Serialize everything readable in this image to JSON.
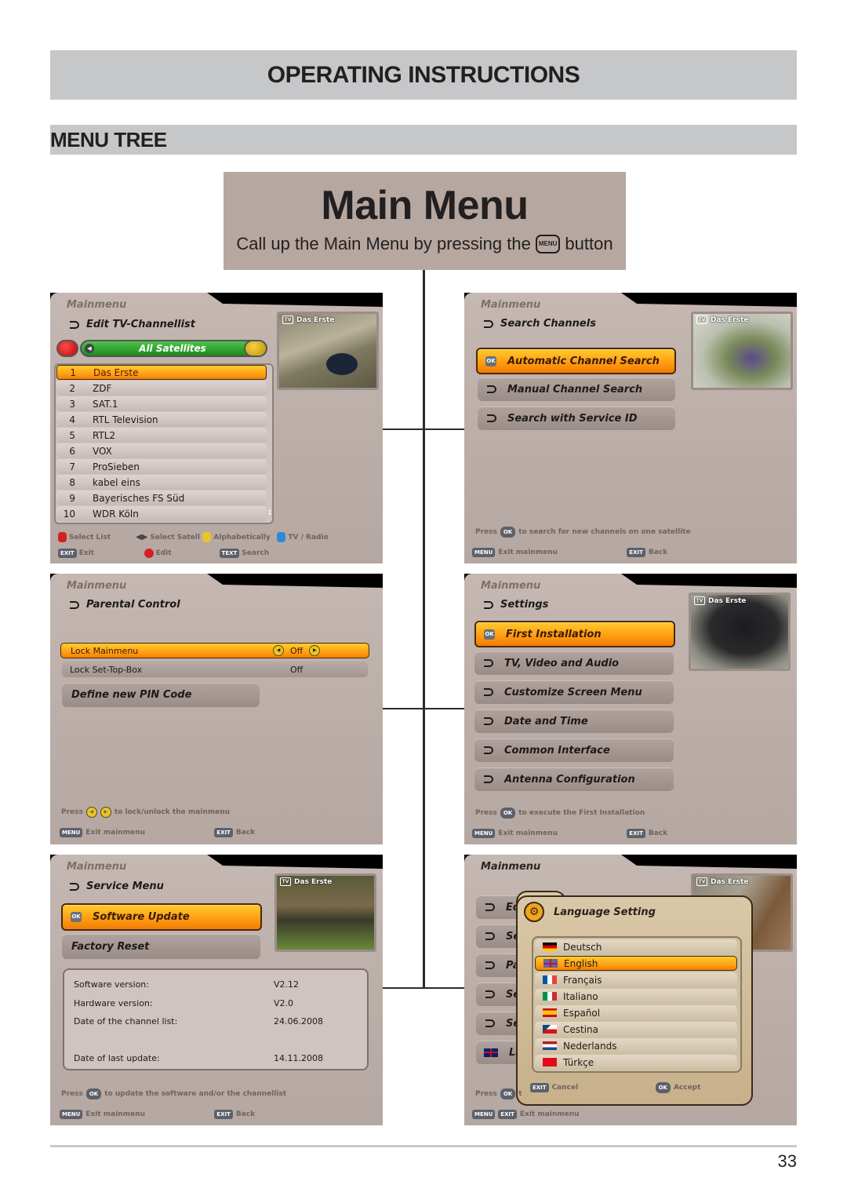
{
  "header": {
    "title": "OPERATING INSTRUCTIONS"
  },
  "section": {
    "title": "MENU TREE"
  },
  "main_menu": {
    "title": "Main Menu",
    "subtitle_before": "Call up the Main Menu by pressing the",
    "key_label": "MENU",
    "subtitle_after": "button"
  },
  "common": {
    "mainmenu": "Mainmenu",
    "channel_thumb": "Das Erste",
    "tv_icon": "TV"
  },
  "panel_channellist": {
    "title": "Edit TV-Channellist",
    "satellite_selector": "All Satellites",
    "channels": [
      {
        "num": "1",
        "name": "Das Erste",
        "selected": true
      },
      {
        "num": "2",
        "name": "ZDF"
      },
      {
        "num": "3",
        "name": "SAT.1"
      },
      {
        "num": "4",
        "name": "RTL Television"
      },
      {
        "num": "5",
        "name": "RTL2"
      },
      {
        "num": "6",
        "name": "VOX"
      },
      {
        "num": "7",
        "name": "ProSieben"
      },
      {
        "num": "8",
        "name": "kabel eins"
      },
      {
        "num": "9",
        "name": "Bayerisches FS Süd"
      },
      {
        "num": "10",
        "name": "WDR Köln"
      }
    ],
    "legend": {
      "select_list": "Select List",
      "select_satellite": "Select Satelli",
      "alphabetically": "Alphabetically",
      "tv_radio": "TV / Radio",
      "exit_key": "EXIT",
      "exit": "Exit",
      "edit": "Edit",
      "text_key": "TEXT",
      "search": "Search"
    }
  },
  "panel_search": {
    "title": "Search Channels",
    "items": [
      {
        "label": "Automatic Channel Search",
        "selected": true
      },
      {
        "label": "Manual Channel Search"
      },
      {
        "label": "Search with Service ID"
      }
    ],
    "hint_press": "Press",
    "hint_key": "OK",
    "hint_text": "to search for new channels on one satellite",
    "menu_key": "MENU",
    "exit_mainmenu": "Exit mainmenu",
    "exit_key": "EXIT",
    "back": "Back"
  },
  "panel_parental": {
    "title": "Parental Control",
    "rows": [
      {
        "label": "Lock Mainmenu",
        "value": "Off",
        "selected": true
      },
      {
        "label": "Lock Set-Top-Box",
        "value": "Off"
      }
    ],
    "define_pin": "Define new PIN Code",
    "hint_press": "Press",
    "hint_text": "to lock/unlock the mainmenu",
    "menu_key": "MENU",
    "exit_mainmenu": "Exit mainmenu",
    "exit_key": "EXIT",
    "back": "Back"
  },
  "panel_settings": {
    "title": "Settings",
    "items": [
      {
        "label": "First Installation",
        "selected": true
      },
      {
        "label": "TV, Video and Audio"
      },
      {
        "label": "Customize Screen Menu"
      },
      {
        "label": "Date and Time"
      },
      {
        "label": "Common Interface"
      },
      {
        "label": "Antenna Configuration"
      }
    ],
    "hint_press": "Press",
    "hint_key": "OK",
    "hint_text": "to execute the First Installation",
    "menu_key": "MENU",
    "exit_mainmenu": "Exit mainmenu",
    "exit_key": "EXIT",
    "back": "Back"
  },
  "panel_service": {
    "title": "Service Menu",
    "items": [
      {
        "label": "Software Update",
        "selected": true
      },
      {
        "label": "Factory Reset"
      }
    ],
    "info": [
      {
        "key": "Software version:",
        "value": "V2.12"
      },
      {
        "key": "Hardware version:",
        "value": "V2.0"
      },
      {
        "key": "Date of the channel list:",
        "value": "24.06.2008"
      },
      {
        "key": "Date of last update:",
        "value": "14.11.2008"
      }
    ],
    "hint_press": "Press",
    "hint_key": "OK",
    "hint_text": "to update the software and/or the channellist",
    "menu_key": "MENU",
    "exit_mainmenu": "Exit mainmenu",
    "exit_key": "EXIT",
    "back": "Back"
  },
  "panel_language": {
    "background_items": [
      "Ed",
      "Se",
      "Pa",
      "Se",
      "Se",
      "La"
    ],
    "popup_title": "Language Setting",
    "languages": [
      {
        "label": "Deutsch",
        "flag": "de"
      },
      {
        "label": "English",
        "flag": "gb",
        "selected": true
      },
      {
        "label": "Français",
        "flag": "fr"
      },
      {
        "label": "Italiano",
        "flag": "it"
      },
      {
        "label": "Español",
        "flag": "es"
      },
      {
        "label": "Cestina",
        "flag": "cz"
      },
      {
        "label": "Nederlands",
        "flag": "nl"
      },
      {
        "label": "Türkçe",
        "flag": "tr"
      }
    ],
    "exit_key": "EXIT",
    "cancel": "Cancel",
    "ok_key": "OK",
    "accept": "Accept",
    "hint_press": "Press",
    "hint_key": "OK",
    "hint_fragment": "t",
    "menu_key": "MENU",
    "exit_mainmenu": "Exit mainmenu"
  },
  "colors": {
    "highlight": "#ff9a10",
    "panel_bg": "#bcaea8",
    "header_gray": "#c6c7c9",
    "main_box": "#b6a7a0"
  },
  "page_number": "33"
}
